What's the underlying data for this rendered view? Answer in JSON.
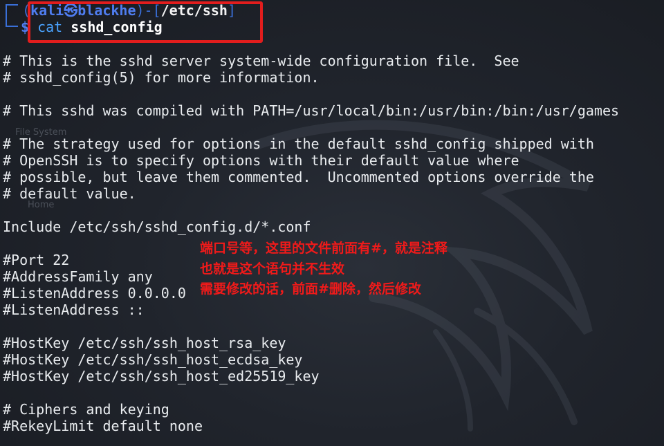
{
  "prompt": {
    "user_host": "kali㉿blackhe",
    "cwd": "/etc/ssh",
    "symbol": "$",
    "command": "cat",
    "argument": "sshd_config"
  },
  "output_lines": [
    "# This is the sshd server system-wide configuration file.  See",
    "# sshd_config(5) for more information.",
    "",
    "# This sshd was compiled with PATH=/usr/local/bin:/usr/bin:/bin:/usr/games",
    "",
    "# The strategy used for options in the default sshd_config shipped with",
    "# OpenSSH is to specify options with their default value where",
    "# possible, but leave them commented.  Uncommented options override the",
    "# default value.",
    "",
    "Include /etc/ssh/sshd_config.d/*.conf",
    "",
    "#Port 22",
    "#AddressFamily any",
    "#ListenAddress 0.0.0.0",
    "#ListenAddress ::",
    "",
    "#HostKey /etc/ssh/ssh_host_rsa_key",
    "#HostKey /etc/ssh/ssh_host_ecdsa_key",
    "#HostKey /etc/ssh/ssh_host_ed25519_key",
    "",
    "# Ciphers and keying",
    "#RekeyLimit default none"
  ],
  "annotation": {
    "line1": "端口号等，这里的文件前面有#，就是注释",
    "line2": "也就是这个语句并不生效",
    "line3": "需要修改的话，前面#删除，然后修改"
  },
  "wallpaper": {
    "file_system": "File System",
    "home": "Home"
  },
  "colors": {
    "background": "#20242c",
    "text": "#e9ecef",
    "prompt_blue": "#4f7df0",
    "highlight_red": "#e21d1d",
    "annotation_red": "#f01a1a"
  }
}
